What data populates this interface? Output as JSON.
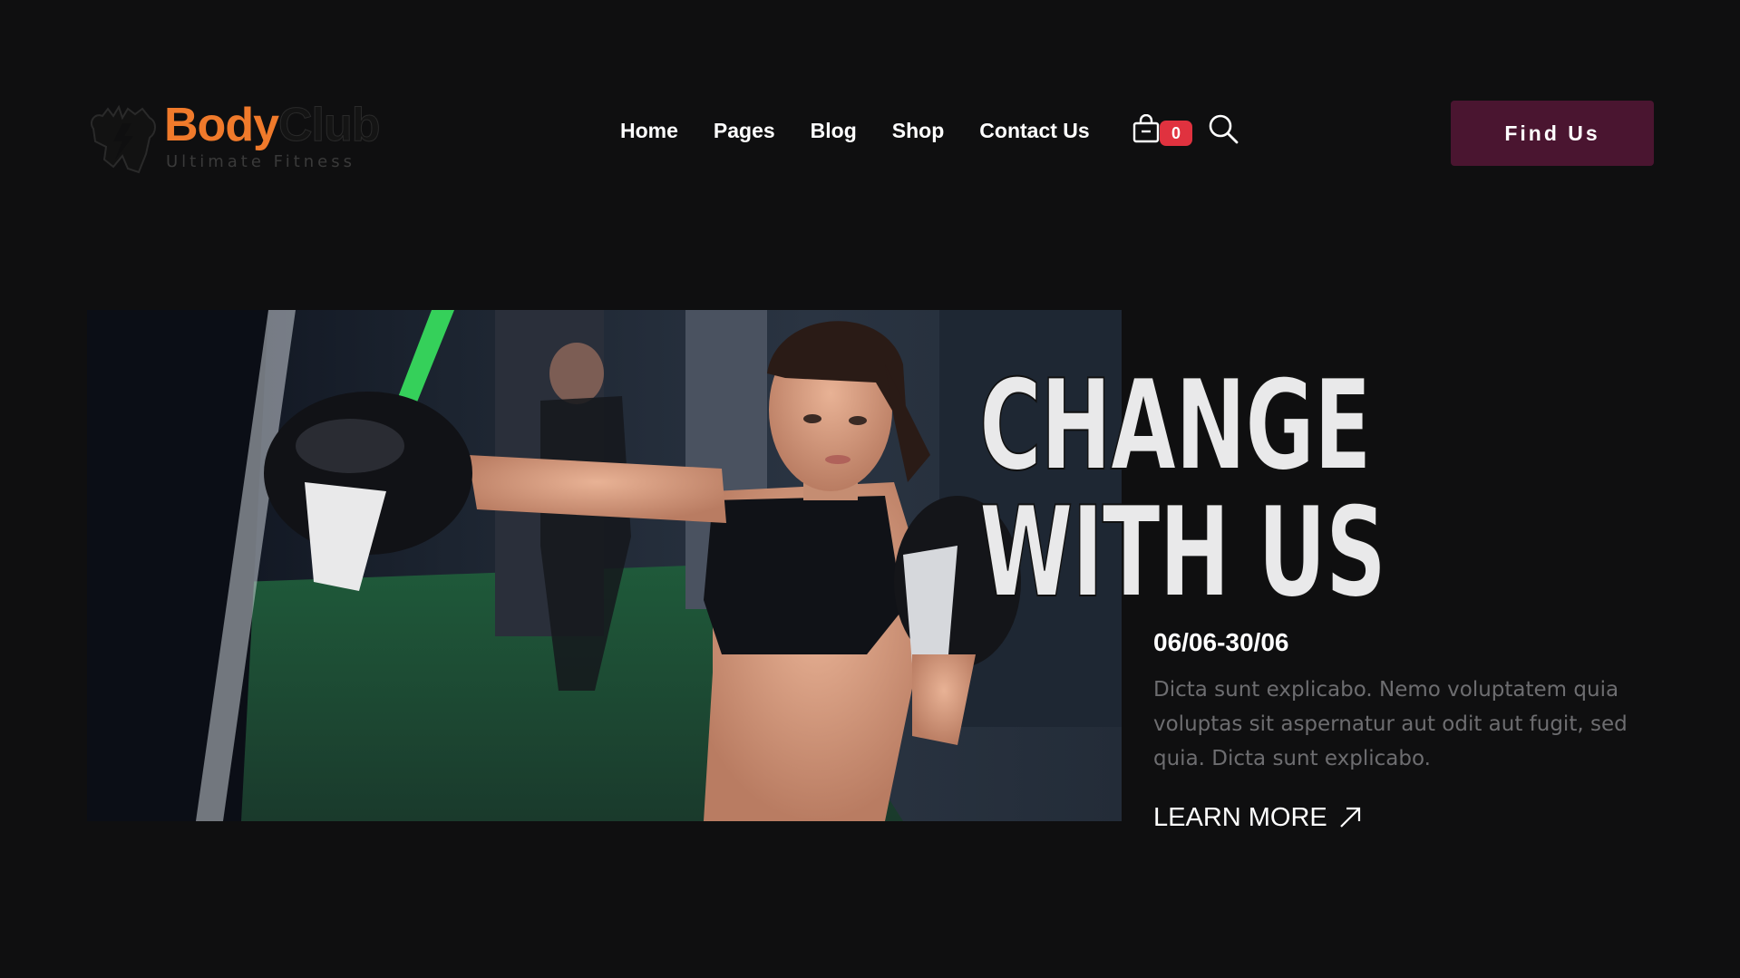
{
  "brand": {
    "name_part1": "Body",
    "name_part2": "Club",
    "tagline": "Ultimate Fitness",
    "accent_color": "#f07a2b"
  },
  "nav": {
    "items": [
      {
        "label": "Home"
      },
      {
        "label": "Pages"
      },
      {
        "label": "Blog"
      },
      {
        "label": "Shop"
      },
      {
        "label": "Contact Us"
      }
    ]
  },
  "cart": {
    "icon": "shopping-bag-icon",
    "count": "0",
    "badge_color": "#e0323f"
  },
  "search": {
    "icon": "search-icon"
  },
  "header": {
    "cta_label": "Find Us",
    "cta_color": "#4a1530"
  },
  "hero": {
    "image": "woman-boxing-photo",
    "headline_line1": "CHANGE",
    "headline_line2": "WITH US",
    "date": "06/06-30/06",
    "description": "Dicta sunt explicabo. Nemo voluptatem quia voluptas sit aspernatur aut odit aut fugit, sed quia. Dicta sunt explicabo.",
    "cta_label": "LEARN MORE",
    "cta_icon": "arrow-up-right-icon"
  }
}
